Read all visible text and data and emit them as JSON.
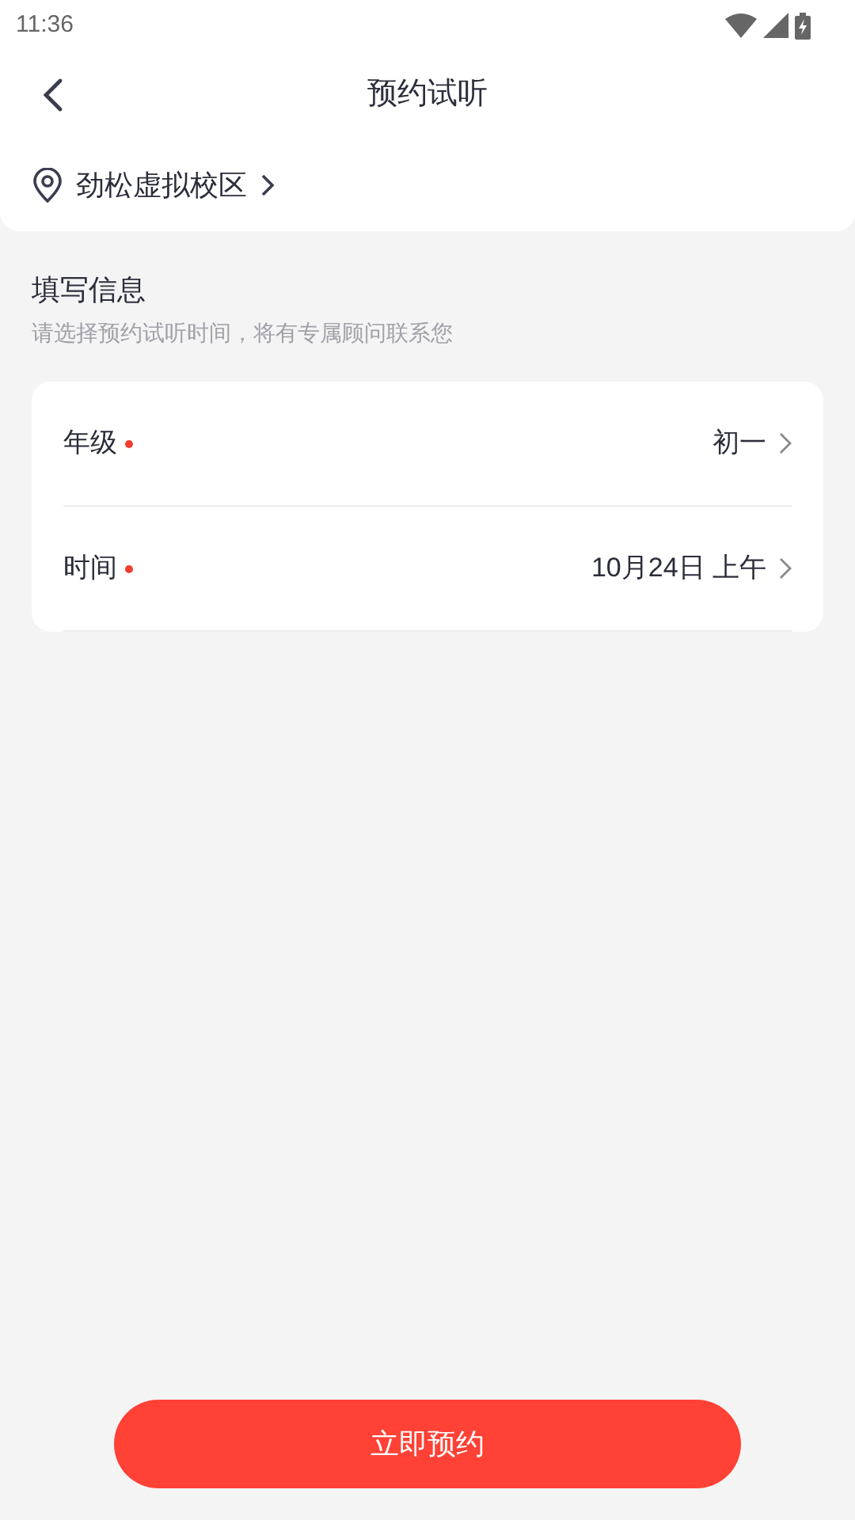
{
  "status_bar": {
    "time": "11:36"
  },
  "header": {
    "title": "预约试听"
  },
  "campus": {
    "name": "劲松虚拟校区"
  },
  "section": {
    "title": "填写信息",
    "subtitle": "请选择预约试听时间，将有专属顾问联系您"
  },
  "fields": [
    {
      "label": "年级",
      "required": true,
      "value": "初一"
    },
    {
      "label": "时间",
      "required": true,
      "value": "10月24日 上午"
    }
  ],
  "submit_button": {
    "label": "立即预约"
  }
}
